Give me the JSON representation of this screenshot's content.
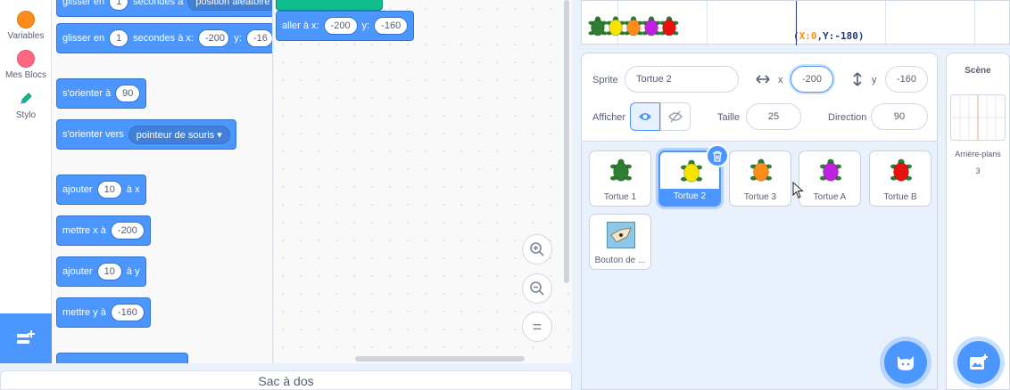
{
  "categories": [
    {
      "label": "Variables",
      "color": "#ff8c1a"
    },
    {
      "label": "Mes Blocs",
      "color": "#ff6680"
    },
    {
      "label": "Stylo",
      "color": "#0fbd8c"
    }
  ],
  "flyout": {
    "glide_top": {
      "prefix": "glisser en",
      "secs": "1",
      "mid": "secondes à",
      "dropdown": "position aléatoire"
    },
    "glide_xy": {
      "prefix": "glisser en",
      "secs": "1",
      "mid": "secondes à x:",
      "x": "-200",
      "ylabel": "y:",
      "y": "-16"
    },
    "point_dir": {
      "label": "s'orienter à",
      "value": "90"
    },
    "point_towards": {
      "label": "s'orienter vers",
      "dropdown": "pointeur de souris"
    },
    "change_x": {
      "label": "ajouter",
      "value": "10",
      "suffix": "à x"
    },
    "set_x": {
      "label": "mettre x à",
      "value": "-200"
    },
    "change_y": {
      "label": "ajouter",
      "value": "10",
      "suffix": "à y"
    },
    "set_y": {
      "label": "mettre y à",
      "value": "-160"
    }
  },
  "script": {
    "goto": {
      "label": "aller à x:",
      "x": "-200",
      "ylabel": "y:",
      "y": "-160"
    }
  },
  "zoom": {
    "in": "+",
    "out": "−",
    "reset": "="
  },
  "backpack": {
    "label": "Sac à dos"
  },
  "stage": {
    "coords_x_label": "X:",
    "coords_x": "0",
    "coords_y_label": "Y:",
    "coords_y": "-180",
    "turtle_colors": [
      "#2e7d32",
      "#f5e400",
      "#ff8c1a",
      "#c020e0",
      "#e81010"
    ]
  },
  "sprite_info": {
    "sprite_label": "Sprite",
    "sprite_name": "Tortue 2",
    "x_label": "x",
    "x_value": "-200",
    "y_label": "y",
    "y_value": "-160",
    "show_label": "Afficher",
    "size_label": "Taille",
    "size_value": "25",
    "direction_label": "Direction",
    "direction_value": "90"
  },
  "sprites": [
    {
      "name": "Tortue 1",
      "color": "#2e7d32"
    },
    {
      "name": "Tortue 2",
      "color": "#f5e400"
    },
    {
      "name": "Tortue 3",
      "color": "#ff8c1a"
    },
    {
      "name": "Tortue A",
      "color": "#c020e0"
    },
    {
      "name": "Tortue B",
      "color": "#e81010"
    },
    {
      "name": "Bouton de ..."
    }
  ],
  "stage_pane": {
    "title": "Scène",
    "backdrops_label": "Arrière-plans",
    "backdrops_count": "3"
  }
}
